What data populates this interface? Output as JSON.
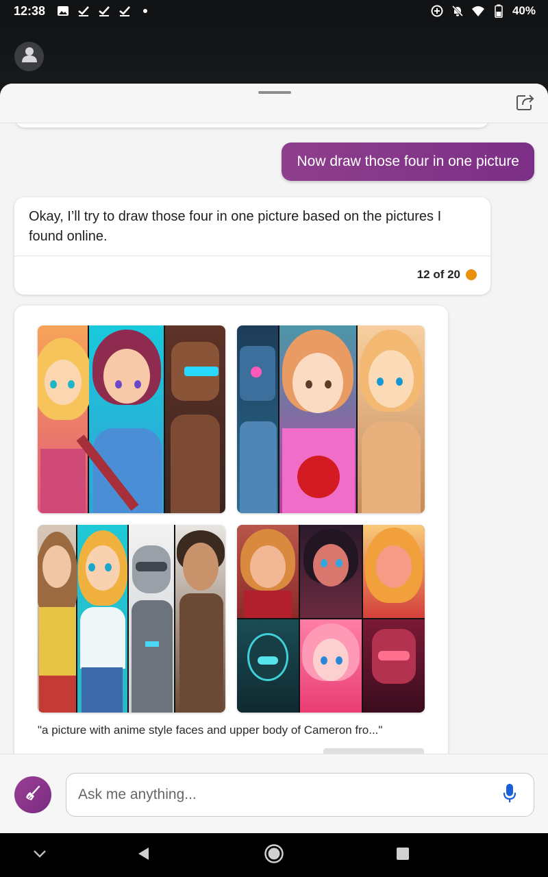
{
  "status_bar": {
    "time": "12:38",
    "battery": "40%",
    "left_icons": [
      "image-icon",
      "check-icon",
      "check-icon",
      "check-icon",
      "dot-icon"
    ],
    "right_icons": [
      "data-saver-icon",
      "bell-off-icon",
      "wifi-icon",
      "battery-icon"
    ]
  },
  "header": {
    "share_icon": "share-icon",
    "avatar_icon": "person-icon"
  },
  "chat": {
    "user_message": "Now draw those four in one picture",
    "bot_message": "Okay, I’ll try to draw those four in one picture based on the pictures I found online.",
    "turn_counter": "12 of 20",
    "counter_color": "#e8910b"
  },
  "image_result": {
    "caption": "\"a picture with anime style faces and upper body of Cameron fro...\""
  },
  "composer": {
    "placeholder": "Ask me anything...",
    "new_topic_icon": "broom-icon",
    "mic_icon": "microphone-icon"
  },
  "colors": {
    "accent": "#8e3f8c",
    "mic": "#1a5fd6"
  }
}
